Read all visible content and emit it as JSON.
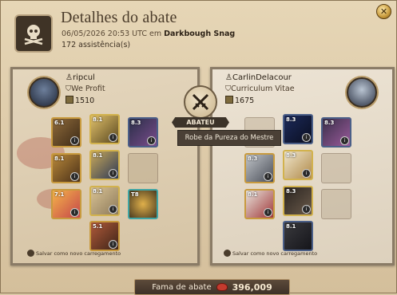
{
  "header": {
    "title": "Detalhes do abate",
    "datetime": "06/05/2026 20:53 UTC em",
    "location": "Darkbough Snag",
    "assists": "172 assistência(s)"
  },
  "killer": {
    "name": "ripcul",
    "guild": "We Profit",
    "item_power": "1510",
    "save_label": "Salvar como novo carregamento"
  },
  "victim": {
    "name": "CarlinDelacour",
    "guild": "Curriculum Vitae",
    "item_power": "1675",
    "save_label": "Salvar como novo carregamento"
  },
  "center": {
    "badge_label": "ABATEU",
    "tooltip": "Robe da Pureza do Mestre"
  },
  "footer": {
    "fame_label": "Fama de abate",
    "fame_value": "396,009"
  },
  "colors": {
    "background": "#dcc8a6",
    "panel_dark": "#3c3329",
    "accent_gold": "#c79a3c",
    "fame_gem": "#c33b2e"
  },
  "icons": [
    "skull-crossbones-icon",
    "close-icon",
    "crossed-swords-icon",
    "fame-gem-icon",
    "item-power-icon",
    "guild-icon",
    "save-loadout-icon"
  ]
}
